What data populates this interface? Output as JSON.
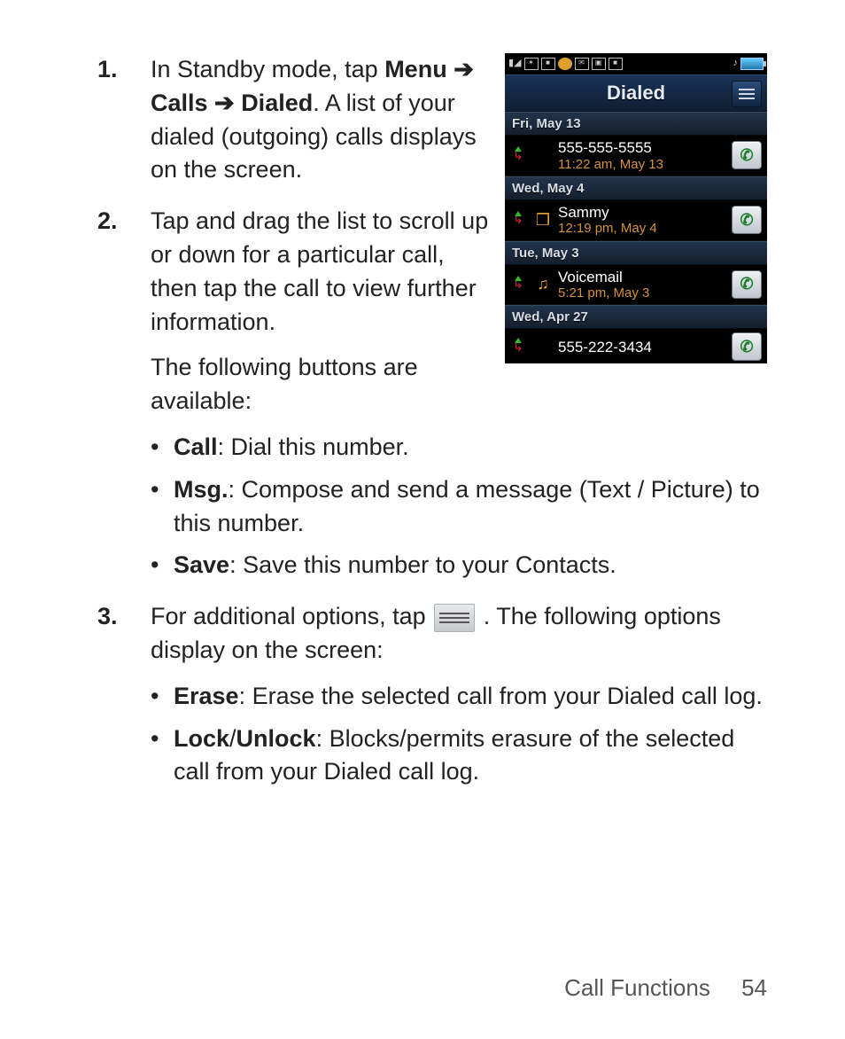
{
  "steps": {
    "s1": {
      "num": "1.",
      "p1a": "In Standby mode, tap ",
      "menu": "Menu",
      "arrow1": " ➔ ",
      "calls": "Calls",
      "arrow2": " ➔ ",
      "dialed": "Dialed",
      "p1b": ". A list of your dialed (outgoing) calls displays on the screen."
    },
    "s2": {
      "num": "2.",
      "p1": "Tap and drag the list to scroll up or down for a particular call, then tap the call to view further information.",
      "p2": "The following buttons are available:",
      "b1_label": "Call",
      "b1_text": ": Dial this number.",
      "b2_label": "Msg.",
      "b2_text": ": Compose and send a message (Text / Picture) to this number.",
      "b3_label": "Save",
      "b3_text": ": Save this number to your Contacts."
    },
    "s3": {
      "num": "3.",
      "p1a": "For additional options, tap ",
      "p1b": ". The following options display on the screen:",
      "b1_label": "Erase",
      "b1_text": ": Erase the selected call from your Dialed call log.",
      "b2_label": "Lock",
      "b2_sep": "/",
      "b2_label2": "Unlock",
      "b2_text": ": Blocks/permits erasure of the selected call from your Dialed call log."
    }
  },
  "phone": {
    "title": "Dialed",
    "groups": [
      {
        "date": "Fri, May 13",
        "entries": [
          {
            "name": "555-555-5555",
            "time": "11:22 am, May 13",
            "contact_icon": ""
          }
        ]
      },
      {
        "date": "Wed, May 4",
        "entries": [
          {
            "name": "Sammy",
            "time": "12:19 pm, May 4",
            "contact_icon": "file"
          }
        ]
      },
      {
        "date": "Tue, May 3",
        "entries": [
          {
            "name": "Voicemail",
            "time": "5:21 pm, May 3",
            "contact_icon": "person"
          }
        ]
      },
      {
        "date": "Wed, Apr 27",
        "entries": [
          {
            "name": "555-222-3434",
            "time": "",
            "contact_icon": ""
          }
        ]
      }
    ]
  },
  "footer": {
    "section": "Call Functions",
    "page": "54"
  }
}
